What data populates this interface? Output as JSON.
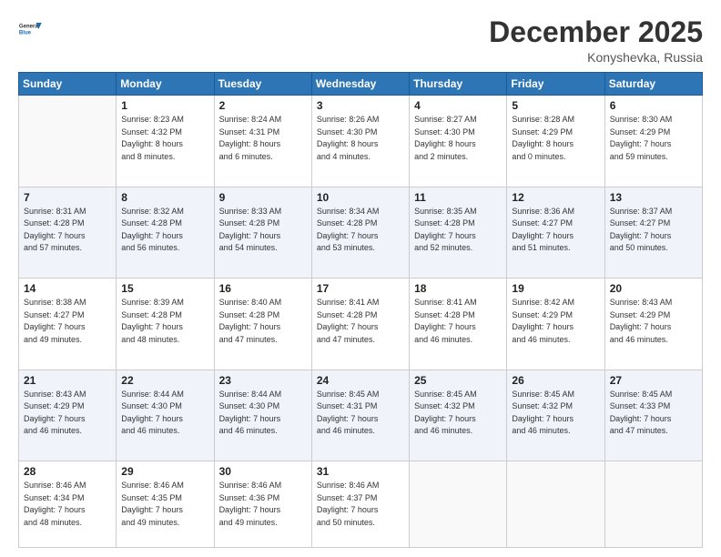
{
  "header": {
    "logo_line1": "General",
    "logo_line2": "Blue",
    "month": "December 2025",
    "location": "Konyshevka, Russia"
  },
  "days_of_week": [
    "Sunday",
    "Monday",
    "Tuesday",
    "Wednesday",
    "Thursday",
    "Friday",
    "Saturday"
  ],
  "weeks": [
    [
      {
        "day": "",
        "info": ""
      },
      {
        "day": "1",
        "info": "Sunrise: 8:23 AM\nSunset: 4:32 PM\nDaylight: 8 hours\nand 8 minutes."
      },
      {
        "day": "2",
        "info": "Sunrise: 8:24 AM\nSunset: 4:31 PM\nDaylight: 8 hours\nand 6 minutes."
      },
      {
        "day": "3",
        "info": "Sunrise: 8:26 AM\nSunset: 4:30 PM\nDaylight: 8 hours\nand 4 minutes."
      },
      {
        "day": "4",
        "info": "Sunrise: 8:27 AM\nSunset: 4:30 PM\nDaylight: 8 hours\nand 2 minutes."
      },
      {
        "day": "5",
        "info": "Sunrise: 8:28 AM\nSunset: 4:29 PM\nDaylight: 8 hours\nand 0 minutes."
      },
      {
        "day": "6",
        "info": "Sunrise: 8:30 AM\nSunset: 4:29 PM\nDaylight: 7 hours\nand 59 minutes."
      }
    ],
    [
      {
        "day": "7",
        "info": "Sunrise: 8:31 AM\nSunset: 4:28 PM\nDaylight: 7 hours\nand 57 minutes."
      },
      {
        "day": "8",
        "info": "Sunrise: 8:32 AM\nSunset: 4:28 PM\nDaylight: 7 hours\nand 56 minutes."
      },
      {
        "day": "9",
        "info": "Sunrise: 8:33 AM\nSunset: 4:28 PM\nDaylight: 7 hours\nand 54 minutes."
      },
      {
        "day": "10",
        "info": "Sunrise: 8:34 AM\nSunset: 4:28 PM\nDaylight: 7 hours\nand 53 minutes."
      },
      {
        "day": "11",
        "info": "Sunrise: 8:35 AM\nSunset: 4:28 PM\nDaylight: 7 hours\nand 52 minutes."
      },
      {
        "day": "12",
        "info": "Sunrise: 8:36 AM\nSunset: 4:27 PM\nDaylight: 7 hours\nand 51 minutes."
      },
      {
        "day": "13",
        "info": "Sunrise: 8:37 AM\nSunset: 4:27 PM\nDaylight: 7 hours\nand 50 minutes."
      }
    ],
    [
      {
        "day": "14",
        "info": "Sunrise: 8:38 AM\nSunset: 4:27 PM\nDaylight: 7 hours\nand 49 minutes."
      },
      {
        "day": "15",
        "info": "Sunrise: 8:39 AM\nSunset: 4:28 PM\nDaylight: 7 hours\nand 48 minutes."
      },
      {
        "day": "16",
        "info": "Sunrise: 8:40 AM\nSunset: 4:28 PM\nDaylight: 7 hours\nand 47 minutes."
      },
      {
        "day": "17",
        "info": "Sunrise: 8:41 AM\nSunset: 4:28 PM\nDaylight: 7 hours\nand 47 minutes."
      },
      {
        "day": "18",
        "info": "Sunrise: 8:41 AM\nSunset: 4:28 PM\nDaylight: 7 hours\nand 46 minutes."
      },
      {
        "day": "19",
        "info": "Sunrise: 8:42 AM\nSunset: 4:29 PM\nDaylight: 7 hours\nand 46 minutes."
      },
      {
        "day": "20",
        "info": "Sunrise: 8:43 AM\nSunset: 4:29 PM\nDaylight: 7 hours\nand 46 minutes."
      }
    ],
    [
      {
        "day": "21",
        "info": "Sunrise: 8:43 AM\nSunset: 4:29 PM\nDaylight: 7 hours\nand 46 minutes."
      },
      {
        "day": "22",
        "info": "Sunrise: 8:44 AM\nSunset: 4:30 PM\nDaylight: 7 hours\nand 46 minutes."
      },
      {
        "day": "23",
        "info": "Sunrise: 8:44 AM\nSunset: 4:30 PM\nDaylight: 7 hours\nand 46 minutes."
      },
      {
        "day": "24",
        "info": "Sunrise: 8:45 AM\nSunset: 4:31 PM\nDaylight: 7 hours\nand 46 minutes."
      },
      {
        "day": "25",
        "info": "Sunrise: 8:45 AM\nSunset: 4:32 PM\nDaylight: 7 hours\nand 46 minutes."
      },
      {
        "day": "26",
        "info": "Sunrise: 8:45 AM\nSunset: 4:32 PM\nDaylight: 7 hours\nand 46 minutes."
      },
      {
        "day": "27",
        "info": "Sunrise: 8:45 AM\nSunset: 4:33 PM\nDaylight: 7 hours\nand 47 minutes."
      }
    ],
    [
      {
        "day": "28",
        "info": "Sunrise: 8:46 AM\nSunset: 4:34 PM\nDaylight: 7 hours\nand 48 minutes."
      },
      {
        "day": "29",
        "info": "Sunrise: 8:46 AM\nSunset: 4:35 PM\nDaylight: 7 hours\nand 49 minutes."
      },
      {
        "day": "30",
        "info": "Sunrise: 8:46 AM\nSunset: 4:36 PM\nDaylight: 7 hours\nand 49 minutes."
      },
      {
        "day": "31",
        "info": "Sunrise: 8:46 AM\nSunset: 4:37 PM\nDaylight: 7 hours\nand 50 minutes."
      },
      {
        "day": "",
        "info": ""
      },
      {
        "day": "",
        "info": ""
      },
      {
        "day": "",
        "info": ""
      }
    ]
  ]
}
